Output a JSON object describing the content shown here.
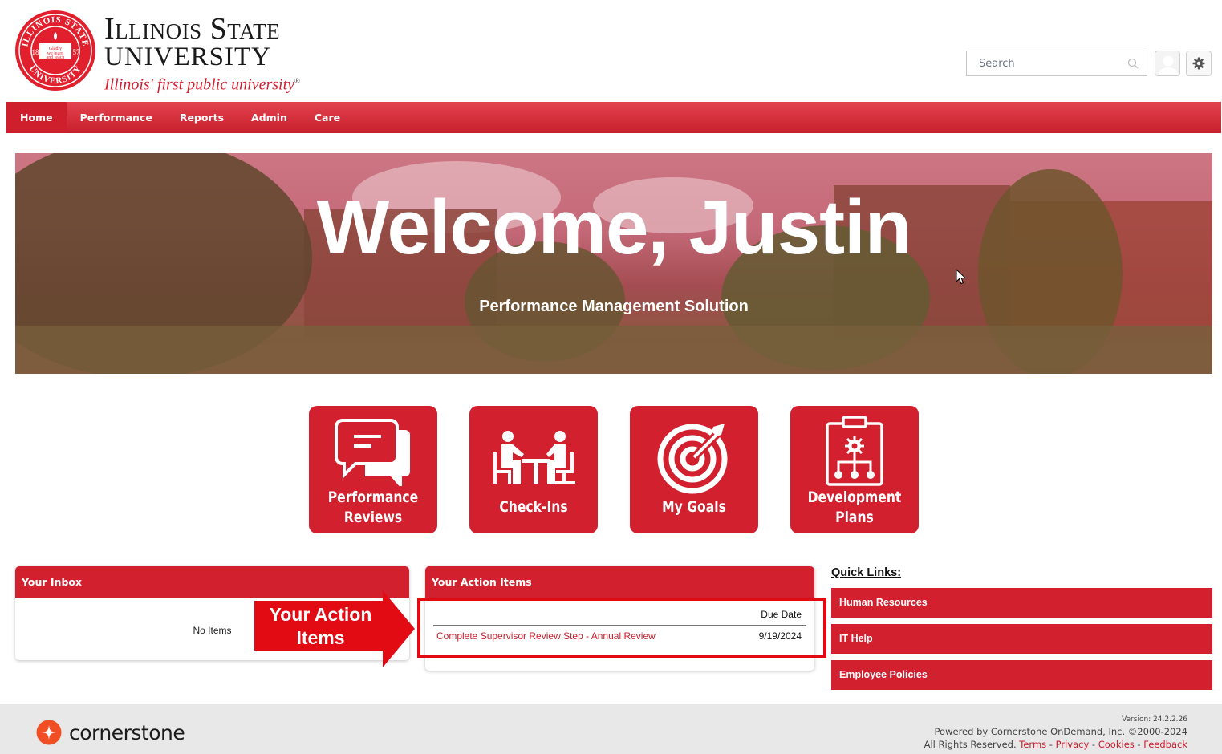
{
  "header": {
    "logo": {
      "line1": "Illinois State",
      "line2": "University",
      "tagline": "Illinois' first public university",
      "seal_top": "ILLINOIS STATE",
      "seal_bottom": "UNIVERSITY",
      "seal_year_left": "18",
      "seal_year_right": "57",
      "seal_motto": "Gladly we learn and teach"
    },
    "search": {
      "placeholder": "Search",
      "value": ""
    },
    "icons": {
      "search": "search-icon",
      "avatar": "user-avatar-icon",
      "settings": "gear-icon"
    }
  },
  "nav": {
    "items": [
      {
        "label": "Home",
        "active": true
      },
      {
        "label": "Performance",
        "active": false
      },
      {
        "label": "Reports",
        "active": false
      },
      {
        "label": "Admin",
        "active": false
      },
      {
        "label": "Care",
        "active": false
      }
    ]
  },
  "banner": {
    "title": "Welcome, Justin",
    "subtitle": "Performance Management Solution"
  },
  "tiles": [
    {
      "line1": "Performance",
      "line2": "Reviews",
      "icon": "chat-bubbles-icon"
    },
    {
      "line1": "Check-Ins",
      "icon": "meeting-icon"
    },
    {
      "line1": "My Goals",
      "icon": "target-icon"
    },
    {
      "line1": "Development",
      "line2": "Plans",
      "icon": "clipboard-plan-icon"
    }
  ],
  "inbox": {
    "title": "Your Inbox",
    "empty_text": "No Items"
  },
  "action_items": {
    "title": "Your Action Items",
    "columns": [
      "",
      "Due Date"
    ],
    "rows": [
      {
        "task": "Complete Supervisor Review Step - Annual Review",
        "due": "9/19/2024"
      }
    ]
  },
  "annotation": {
    "callout_line1": "Your Action",
    "callout_line2": "Items"
  },
  "quick_links": {
    "title": "Quick Links:",
    "items": [
      "Human Resources",
      "IT Help",
      "Employee Policies"
    ]
  },
  "footer": {
    "brand": "cornerstone",
    "version": "Version: 24.2.2.26",
    "powered_by": "Powered by Cornerstone OnDemand, Inc. ©2000-2024",
    "rights": "All Rights Reserved.",
    "links": [
      "Terms",
      "Privacy",
      "Cookies",
      "Feedback"
    ],
    "separator": " - "
  },
  "colors": {
    "brand_red": "#d3202f",
    "annotation_red": "#e30b13",
    "link_red": "#c8202e",
    "footer_bg": "#e8e8e8"
  }
}
